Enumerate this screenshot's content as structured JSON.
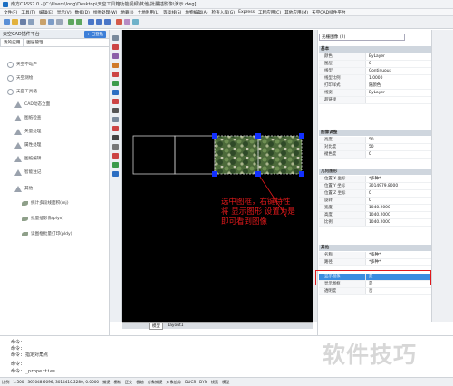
{
  "titlebar": {
    "title": "南方CASS7.0 - [C:\\Users\\long\\Desktop\\天空工具箱功能视频\\其他\\批量插影像\\演示.dwg]"
  },
  "menu": [
    "文件(F)",
    "工具(T)",
    "编辑(E)",
    "显示(V)",
    "数据(D)",
    "绘图处理(W)",
    "地籍(J)",
    "土地利用(L)",
    "等高线(S)",
    "地物编辑(A)",
    "检查入库(G)",
    "Express",
    "工程应用(C)",
    "其他应用(M)",
    "天空CAD插件平台"
  ],
  "left_panel": {
    "title": "天空CAD插件平台",
    "header_button": "+ 已登陆",
    "tabs": [
      "我的应用",
      "图层管理"
    ],
    "items": [
      "天空不动产",
      "天空测绘",
      "天空工具箱",
      "CAD动态立面",
      "图纸检查",
      "矢量处理",
      "属性处理",
      "图纸编辑",
      "智能注记",
      "其他",
      "统计多段线面积(mj)",
      "批量插影像(plyx)",
      "读图框批量打印(pldy)"
    ]
  },
  "canvas_tabs": [
    "模型",
    "Layout1"
  ],
  "annotation": [
    "选中图框，右键特性",
    "将 显示图形 设置为是",
    "即可看到图像"
  ],
  "properties": {
    "selector": "光栅图像 (2)",
    "sections": [
      {
        "title": "基本",
        "rows": [
          [
            "颜色",
            "ByLayer"
          ],
          [
            "图层",
            "0"
          ],
          [
            "线型",
            "Continuous"
          ],
          [
            "线型比例",
            "1.0000"
          ],
          [
            "打印样式",
            "随颜色"
          ],
          [
            "线宽",
            "ByLayer"
          ],
          [
            "超链接",
            ""
          ]
        ]
      },
      {
        "title": "图像调整",
        "rows": [
          [
            "亮度",
            "50"
          ],
          [
            "对比度",
            "50"
          ],
          [
            "褪色度",
            "0"
          ]
        ]
      },
      {
        "title": "几何图形",
        "rows": [
          [
            "位置 X 坐标",
            "*多种*"
          ],
          [
            "位置 Y 坐标",
            "3014979.8000"
          ],
          [
            "位置 Z 坐标",
            "0"
          ],
          [
            "旋转",
            "0"
          ],
          [
            "宽度",
            "1040.2000"
          ],
          [
            "高度",
            "1040.2000"
          ],
          [
            "比例",
            "1040.2000"
          ]
        ]
      },
      {
        "title": "其他",
        "rows": [
          [
            "名称",
            "*多种*"
          ],
          [
            "路径",
            "*多种*"
          ],
          [
            "显示图像",
            "是"
          ],
          [
            "显示图框",
            "是"
          ],
          [
            "透明度",
            "否"
          ]
        ]
      }
    ],
    "selected_row": "显示图像"
  },
  "command": {
    "lines": [
      "命令:",
      "命令:",
      "命令: 指定对角点",
      "命令:",
      "命令: _properties"
    ]
  },
  "statusbar": [
    "比例",
    "1:500",
    "361048.6096, 3014410.2280, 0.0000",
    "捕捉",
    "栅格",
    "正交",
    "极轴",
    "对象捕捉",
    "对象追踪",
    "DUCS",
    "DYN",
    "线宽",
    "模型"
  ],
  "watermark": "软件技巧",
  "colors": {
    "accent": "#3b8de0",
    "annotation": "#e0191b",
    "grip": "#1230ff"
  }
}
